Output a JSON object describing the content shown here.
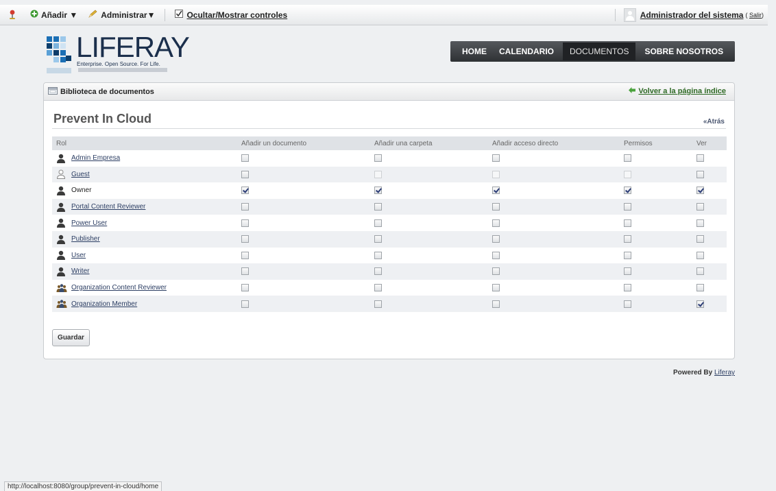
{
  "dockbar": {
    "add_label": "Añadir ▼",
    "manage_label": "Administrar▼",
    "toggle_label": "Ocultar/Mostrar controles",
    "user_name": "Administrador del sistema",
    "logout_open": "(",
    "logout_label": "Salir",
    "logout_close": ")"
  },
  "logo": {
    "name": "LIFERAY",
    "tagline": "Enterprise. Open Source. For Life."
  },
  "nav": {
    "items": [
      {
        "label": "HOME",
        "active": false
      },
      {
        "label": "CALENDARIO",
        "active": false
      },
      {
        "label": "DOCUMENTOS",
        "active": true
      },
      {
        "label": "SOBRE NOSOTROS",
        "active": false
      }
    ]
  },
  "portlet": {
    "title": "Biblioteca de documentos",
    "back_label": "Volver a la página índice",
    "page_title": "Prevent In Cloud",
    "back_short": "«Atrás",
    "save_label": "Guardar"
  },
  "table": {
    "headers": [
      "Rol",
      "Añadir un documento",
      "Añadir una carpeta",
      "Añadir acceso directo",
      "Permisos",
      "Ver"
    ],
    "rows": [
      {
        "role": "Admin Empresa",
        "icon": "user-icon",
        "link": true,
        "checks": [
          0,
          0,
          0,
          0,
          0
        ],
        "disabled": [
          0,
          0,
          0,
          0,
          0
        ]
      },
      {
        "role": "Guest",
        "icon": "guest-user-icon",
        "link": true,
        "checks": [
          0,
          0,
          0,
          0,
          0
        ],
        "disabled": [
          0,
          1,
          1,
          1,
          0
        ]
      },
      {
        "role": "Owner",
        "icon": "user-icon",
        "link": false,
        "checks": [
          1,
          1,
          1,
          1,
          1
        ],
        "disabled": [
          0,
          0,
          0,
          0,
          0
        ]
      },
      {
        "role": "Portal Content Reviewer",
        "icon": "user-icon",
        "link": true,
        "checks": [
          0,
          0,
          0,
          0,
          0
        ],
        "disabled": [
          0,
          0,
          0,
          0,
          0
        ]
      },
      {
        "role": "Power User",
        "icon": "user-icon",
        "link": true,
        "checks": [
          0,
          0,
          0,
          0,
          0
        ],
        "disabled": [
          0,
          0,
          0,
          0,
          0
        ]
      },
      {
        "role": "Publisher",
        "icon": "user-icon",
        "link": true,
        "checks": [
          0,
          0,
          0,
          0,
          0
        ],
        "disabled": [
          0,
          0,
          0,
          0,
          0
        ]
      },
      {
        "role": "User",
        "icon": "user-icon",
        "link": true,
        "checks": [
          0,
          0,
          0,
          0,
          0
        ],
        "disabled": [
          0,
          0,
          0,
          0,
          0
        ]
      },
      {
        "role": "Writer",
        "icon": "user-icon",
        "link": true,
        "checks": [
          0,
          0,
          0,
          0,
          0
        ],
        "disabled": [
          0,
          0,
          0,
          0,
          0
        ]
      },
      {
        "role": "Organization Content Reviewer",
        "icon": "organization-role-icon",
        "link": true,
        "checks": [
          0,
          0,
          0,
          0,
          0
        ],
        "disabled": [
          0,
          0,
          0,
          0,
          0
        ]
      },
      {
        "role": "Organization Member",
        "icon": "organization-role-icon",
        "link": true,
        "checks": [
          0,
          0,
          0,
          0,
          1
        ],
        "disabled": [
          0,
          0,
          0,
          0,
          0
        ]
      }
    ]
  },
  "footer": {
    "powered_prefix": "Powered By",
    "powered_link": "Liferay"
  },
  "status_bar": {
    "url": "http://localhost:8080/group/prevent-in-cloud/home"
  }
}
